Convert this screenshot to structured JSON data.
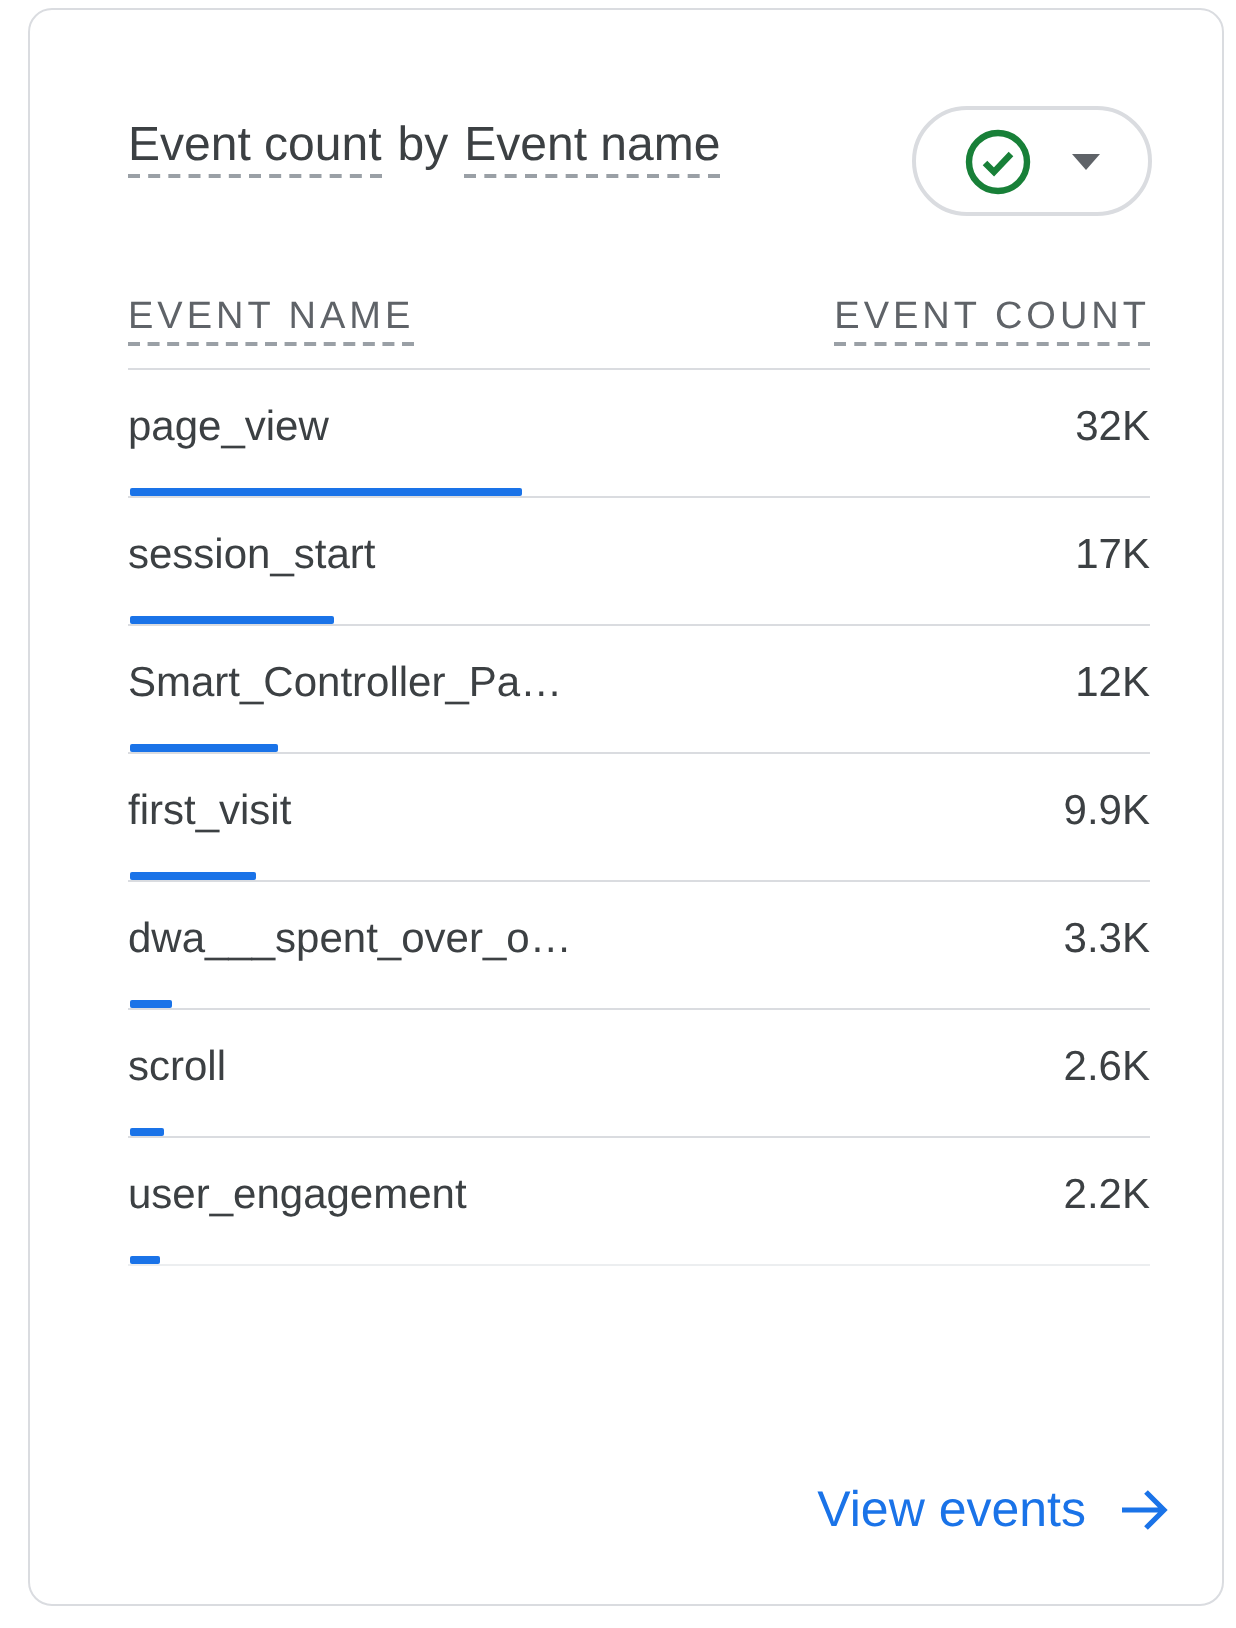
{
  "card": {
    "title_parts": [
      "Event count",
      "by",
      "Event name"
    ],
    "columns": [
      "EVENT NAME",
      "EVENT COUNT"
    ],
    "rows": [
      {
        "name": "page_view",
        "count": "32K",
        "level": 0.385
      },
      {
        "name": "session_start",
        "count": "17K",
        "level": 0.2
      },
      {
        "name": "Smart_Controller_Pa…",
        "count": "12K",
        "level": 0.146
      },
      {
        "name": "first_visit",
        "count": "9.9K",
        "level": 0.123
      },
      {
        "name": "dwa___spent_over_o…",
        "count": "3.3K",
        "level": 0.041
      },
      {
        "name": "scroll",
        "count": "2.6K",
        "level": 0.033
      },
      {
        "name": "user_engagement",
        "count": "2.2K",
        "level": 0.029
      }
    ],
    "link": "View events"
  }
}
